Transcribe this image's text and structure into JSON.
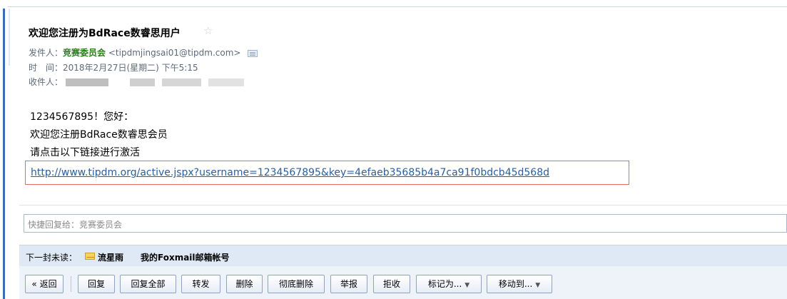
{
  "email": {
    "subject": "欢迎您注册为BdRace数睿思用户",
    "star_icon": "☆",
    "from_label": "发件人：",
    "from_name": "竞赛委员会",
    "from_address": "<tipdmjingsai01@tipdm.com>",
    "time_label": "时　间：",
    "time_value": "2018年2月27日(星期二) 下午5:15",
    "to_label": "收件人：",
    "greeting": "1234567895！您好：",
    "line1": "欢迎您注册BdRace数睿思会员",
    "line2": "请点击以下链接进行激活",
    "link": "http://www.tipdm.org/active.jspx?username=1234567895&key=4efaeb35685b4a7ca91f0bdcb45d568d"
  },
  "quick_reply": {
    "placeholder": "快捷回复给：竞赛委员会"
  },
  "next_unread": {
    "label": "下一封未读：",
    "sender": "流星雨",
    "subject": "我的Foxmail邮箱帐号"
  },
  "toolbar": {
    "back": "« 返回",
    "reply": "回复",
    "reply_all": "回复全部",
    "forward": "转发",
    "delete": "删除",
    "delete_permanently": "彻底删除",
    "report": "举报",
    "reject": "拒收",
    "mark_as": "标记为...",
    "move_to": "移动到...",
    "dropdown_arrow": "▼"
  },
  "colors": {
    "sender_name": "#2e7d1e",
    "link": "#2b5e9e",
    "highlight_border": "#e06b6b",
    "next_bar_bg": "#dfe9f6"
  }
}
